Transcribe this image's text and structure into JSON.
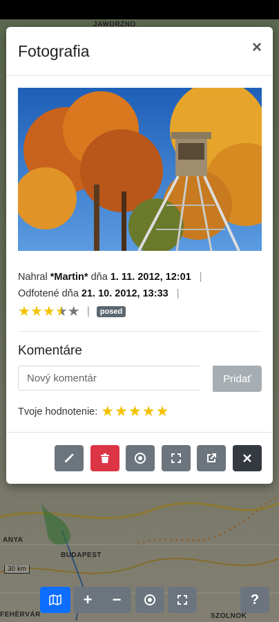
{
  "map": {
    "labels": [
      "JAWORZNO",
      "BUDAPEST",
      "ANYA",
      "SZOLNOK",
      "FEHÉRVÁR"
    ],
    "scale": "30 km"
  },
  "modal": {
    "title": "Fotografia",
    "close_icon": "times-icon",
    "photo_alt": "Autumn trees with a wooden hunting tower",
    "meta": {
      "uploaded_prefix": "Nahral",
      "uploader": "*Martin*",
      "uploaded_on": "dňa",
      "uploaded_date": "1. 11. 2012, 12:01",
      "taken_prefix": "Odfotené dňa",
      "taken_date": "21. 10. 2012, 13:33",
      "rating": 3.5,
      "rating_max": 5,
      "badge": "posed"
    },
    "comments": {
      "heading": "Komentáre",
      "placeholder": "Nový komentár",
      "submit": "Pridať",
      "your_rating_label": "Tvoje hodnotenie:",
      "your_rating_stars": 5
    },
    "footer_buttons": [
      {
        "icon": "pencil-icon",
        "style": "secondary"
      },
      {
        "icon": "trash-icon",
        "style": "danger"
      },
      {
        "icon": "target-icon",
        "style": "secondary"
      },
      {
        "icon": "fullscreen-icon",
        "style": "secondary"
      },
      {
        "icon": "external-link-icon",
        "style": "secondary"
      },
      {
        "icon": "close-icon",
        "style": "dark"
      }
    ]
  },
  "map_toolbar": {
    "buttons": [
      "map-icon",
      "zoom-in-icon",
      "zoom-out-icon",
      "locate-icon",
      "fullscreen-icon",
      "help-icon"
    ],
    "help_label": "?"
  },
  "colors": {
    "primary": "#0d6efd",
    "secondary": "#6c757d",
    "danger": "#dc3545",
    "dark": "#343a40",
    "star": "#f2c200"
  }
}
